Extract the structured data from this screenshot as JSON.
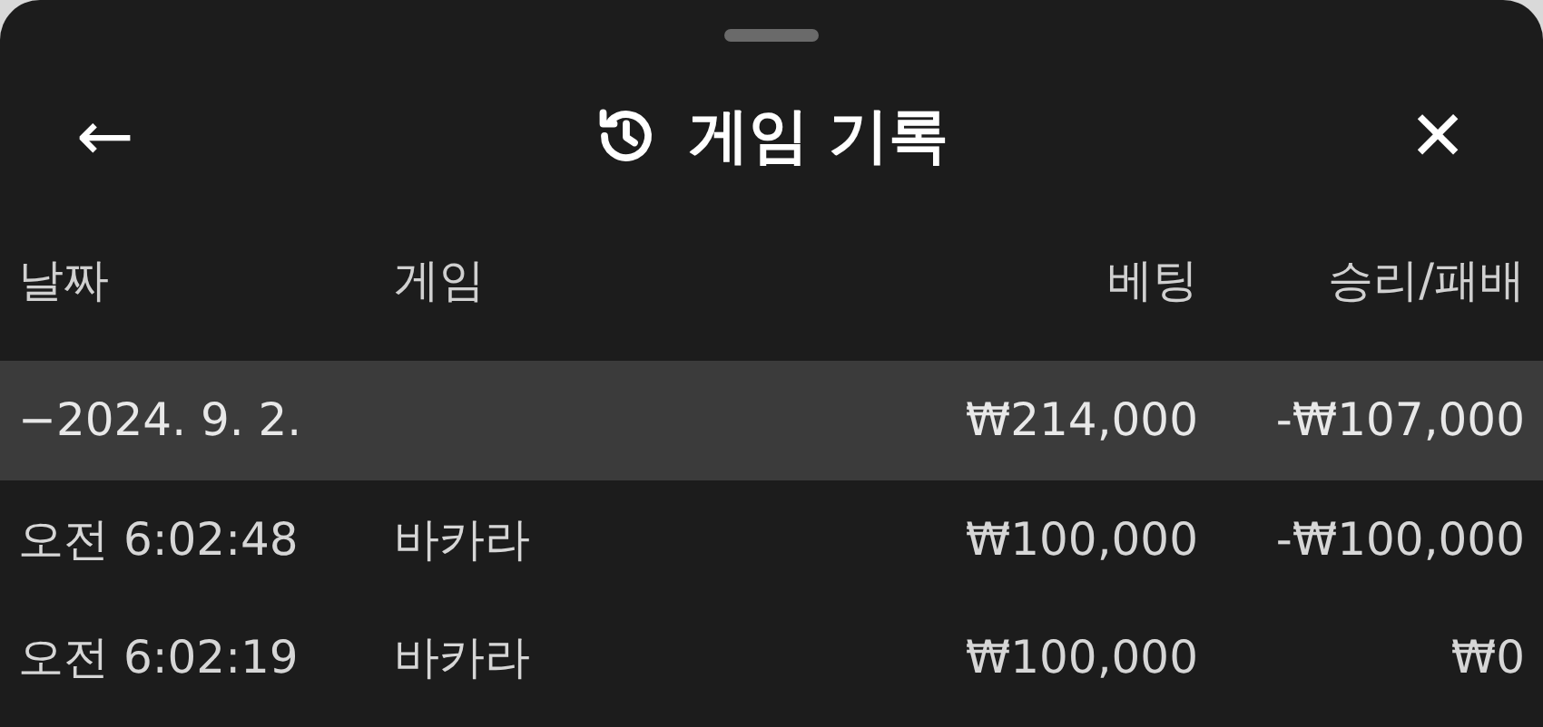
{
  "header": {
    "title": "게임 기록",
    "back": "←",
    "close": "✕"
  },
  "columns": [
    "날짜",
    "게임",
    "베팅",
    "승리/패배"
  ],
  "groups": [
    {
      "date": "2024. 9. 2.",
      "toggle": "−",
      "expanded": true,
      "bet": "₩214,000",
      "result": "-₩107,000",
      "rows": [
        {
          "time": "오전 6:02:48",
          "game": "바카라",
          "bet": "₩100,000",
          "result": "-₩100,000"
        },
        {
          "time": "오전 6:02:19",
          "game": "바카라",
          "bet": "₩100,000",
          "result": "₩0"
        }
      ]
    }
  ]
}
